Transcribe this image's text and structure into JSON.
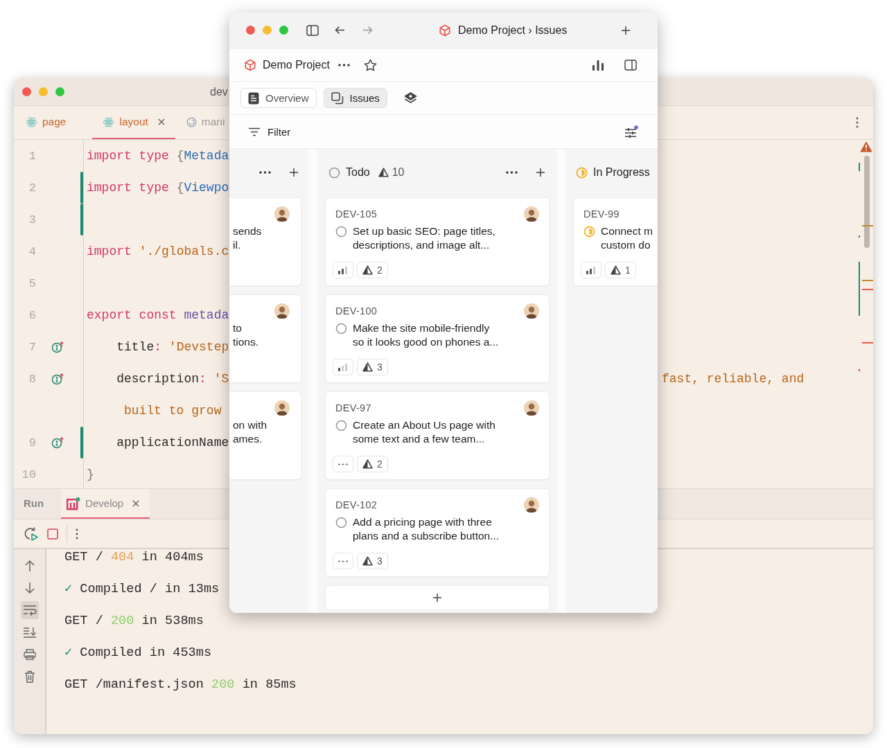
{
  "ide": {
    "title": "dev",
    "tabs": [
      {
        "label": "page",
        "kind": "react",
        "selected": false,
        "closable": false
      },
      {
        "label": "layout",
        "kind": "react",
        "selected": true,
        "closable": true
      },
      {
        "label": "mani",
        "kind": "spiral",
        "selected": false,
        "closable": false
      }
    ],
    "code_rows": [
      {
        "number": "1",
        "gutter_icon": false,
        "changed": false,
        "segments": [
          {
            "kind": "keyword",
            "text": "import type "
          },
          {
            "kind": "punct",
            "text": "{"
          },
          {
            "kind": "type",
            "text": "Metada"
          }
        ]
      },
      {
        "number": "2",
        "gutter_icon": false,
        "changed": true,
        "segments": [
          {
            "kind": "keyword",
            "text": "import type "
          },
          {
            "kind": "punct",
            "text": "{"
          },
          {
            "kind": "type",
            "text": "Viewpo"
          }
        ]
      },
      {
        "number": "3",
        "gutter_icon": false,
        "changed": true,
        "segments": []
      },
      {
        "number": "4",
        "gutter_icon": false,
        "changed": false,
        "segments": [
          {
            "kind": "keyword",
            "text": "import "
          },
          {
            "kind": "string",
            "text": "'./globals.c"
          }
        ]
      },
      {
        "number": "5",
        "gutter_icon": false,
        "changed": false,
        "segments": []
      },
      {
        "number": "6",
        "gutter_icon": false,
        "changed": false,
        "segments": [
          {
            "kind": "keyword",
            "text": "export const "
          },
          {
            "kind": "variable",
            "text": "metada"
          }
        ]
      },
      {
        "number": "7",
        "gutter_icon": true,
        "changed": false,
        "segments": [
          {
            "kind": "plain",
            "text": "    title"
          },
          {
            "kind": "keyword",
            "text": ":"
          },
          {
            "kind": "string",
            "text": " 'Devstep"
          }
        ]
      },
      {
        "number": "8",
        "gutter_icon": true,
        "changed": false,
        "segments": [
          {
            "kind": "plain",
            "text": "    description"
          },
          {
            "kind": "keyword",
            "text": ":"
          },
          {
            "kind": "string",
            "text": " 'S"
          }
        ],
        "tail": [
          {
            "kind": "string",
            "text": "fast, reliable, and"
          }
        ]
      },
      {
        "gutter_icon": false,
        "changed": false,
        "segments": [
          {
            "kind": "string",
            "text": "     built to grow"
          }
        ]
      },
      {
        "number": "9",
        "gutter_icon": true,
        "changed": true,
        "segments": [
          {
            "kind": "plain",
            "text": "    applicationName"
          }
        ]
      },
      {
        "number": "10",
        "gutter_icon": false,
        "changed": false,
        "segments": [
          {
            "kind": "punct",
            "text": "}"
          }
        ]
      }
    ],
    "panel_tabs": [
      {
        "label": "Run",
        "selected": false,
        "kind": "header"
      },
      {
        "label": "Develop",
        "selected": true,
        "kind": "config"
      }
    ],
    "side_tools": [
      {
        "kind": "up",
        "selected": false
      },
      {
        "kind": "down",
        "selected": false
      },
      {
        "kind": "wrap",
        "selected": true
      },
      {
        "kind": "scroll_end",
        "selected": false
      },
      {
        "kind": "print",
        "selected": false
      },
      {
        "kind": "trash",
        "selected": false
      }
    ],
    "terminal": [
      {
        "segments": [
          {
            "kind": "plain",
            "text": "GET / "
          },
          {
            "kind": "warn",
            "text": "404"
          },
          {
            "kind": "plain",
            "text": " in 404ms"
          }
        ]
      },
      {
        "segments": [
          {
            "kind": "check",
            "text": "✓"
          },
          {
            "kind": "plain",
            "text": " Compiled / in 13ms"
          }
        ]
      },
      {
        "segments": [
          {
            "kind": "plain",
            "text": "GET / "
          },
          {
            "kind": "ok",
            "text": "200"
          },
          {
            "kind": "plain",
            "text": " in 538ms"
          }
        ]
      },
      {
        "segments": [
          {
            "kind": "check",
            "text": "✓"
          },
          {
            "kind": "plain",
            "text": " Compiled in 453ms"
          }
        ]
      },
      {
        "segments": [
          {
            "kind": "plain",
            "text": "GET /manifest.json "
          },
          {
            "kind": "ok",
            "text": "200"
          },
          {
            "kind": "plain",
            "text": " in 85ms"
          }
        ]
      }
    ]
  },
  "app": {
    "breadcrumb": "Demo Project › Issues",
    "project": {
      "name": "Demo Project",
      "favorite": false
    },
    "views": [
      {
        "label": "Overview",
        "kind": "doc",
        "selected": false
      },
      {
        "label": "Issues",
        "kind": "copy",
        "selected": true
      }
    ],
    "filter": {
      "label": "Filter",
      "display_badge": true
    },
    "columns": [
      {
        "kind": "partial",
        "cards": [
          {
            "lines": [
              "sends",
              "il."
            ]
          },
          {
            "lines": [
              "to",
              "tions."
            ]
          },
          {
            "lines": [
              "on with",
              "ames."
            ]
          }
        ]
      },
      {
        "kind": "todo",
        "name": "Todo",
        "count": "10",
        "cards": [
          {
            "id": "DEV-105",
            "kind": "todo",
            "lines": [
              "Set up basic SEO: page titles,",
              "descriptions, and image alt..."
            ],
            "priority": {
              "kind": "bars",
              "level": 0.67
            },
            "estimate": "2"
          },
          {
            "id": "DEV-100",
            "kind": "todo",
            "lines": [
              "Make the site mobile-friendly",
              "so it looks good on phones a..."
            ],
            "priority": {
              "kind": "bars",
              "level": 0.33
            },
            "estimate": "3"
          },
          {
            "id": "DEV-97",
            "kind": "todo",
            "lines": [
              "Create an About Us page with",
              "some text and a few team..."
            ],
            "priority": {
              "kind": "none"
            },
            "estimate": "2"
          },
          {
            "id": "DEV-102",
            "kind": "todo",
            "lines": [
              "Add a pricing page with three",
              "plans and a subscribe button..."
            ],
            "priority": {
              "kind": "none"
            },
            "estimate": "3"
          }
        ]
      },
      {
        "kind": "in_progress",
        "name": "In Progress",
        "cards": [
          {
            "id": "DEV-99",
            "kind": "in_progress",
            "lines": [
              "Connect m",
              "custom do"
            ],
            "priority": {
              "kind": "bars",
              "level": 0.67
            },
            "estimate": "1"
          }
        ]
      }
    ]
  }
}
